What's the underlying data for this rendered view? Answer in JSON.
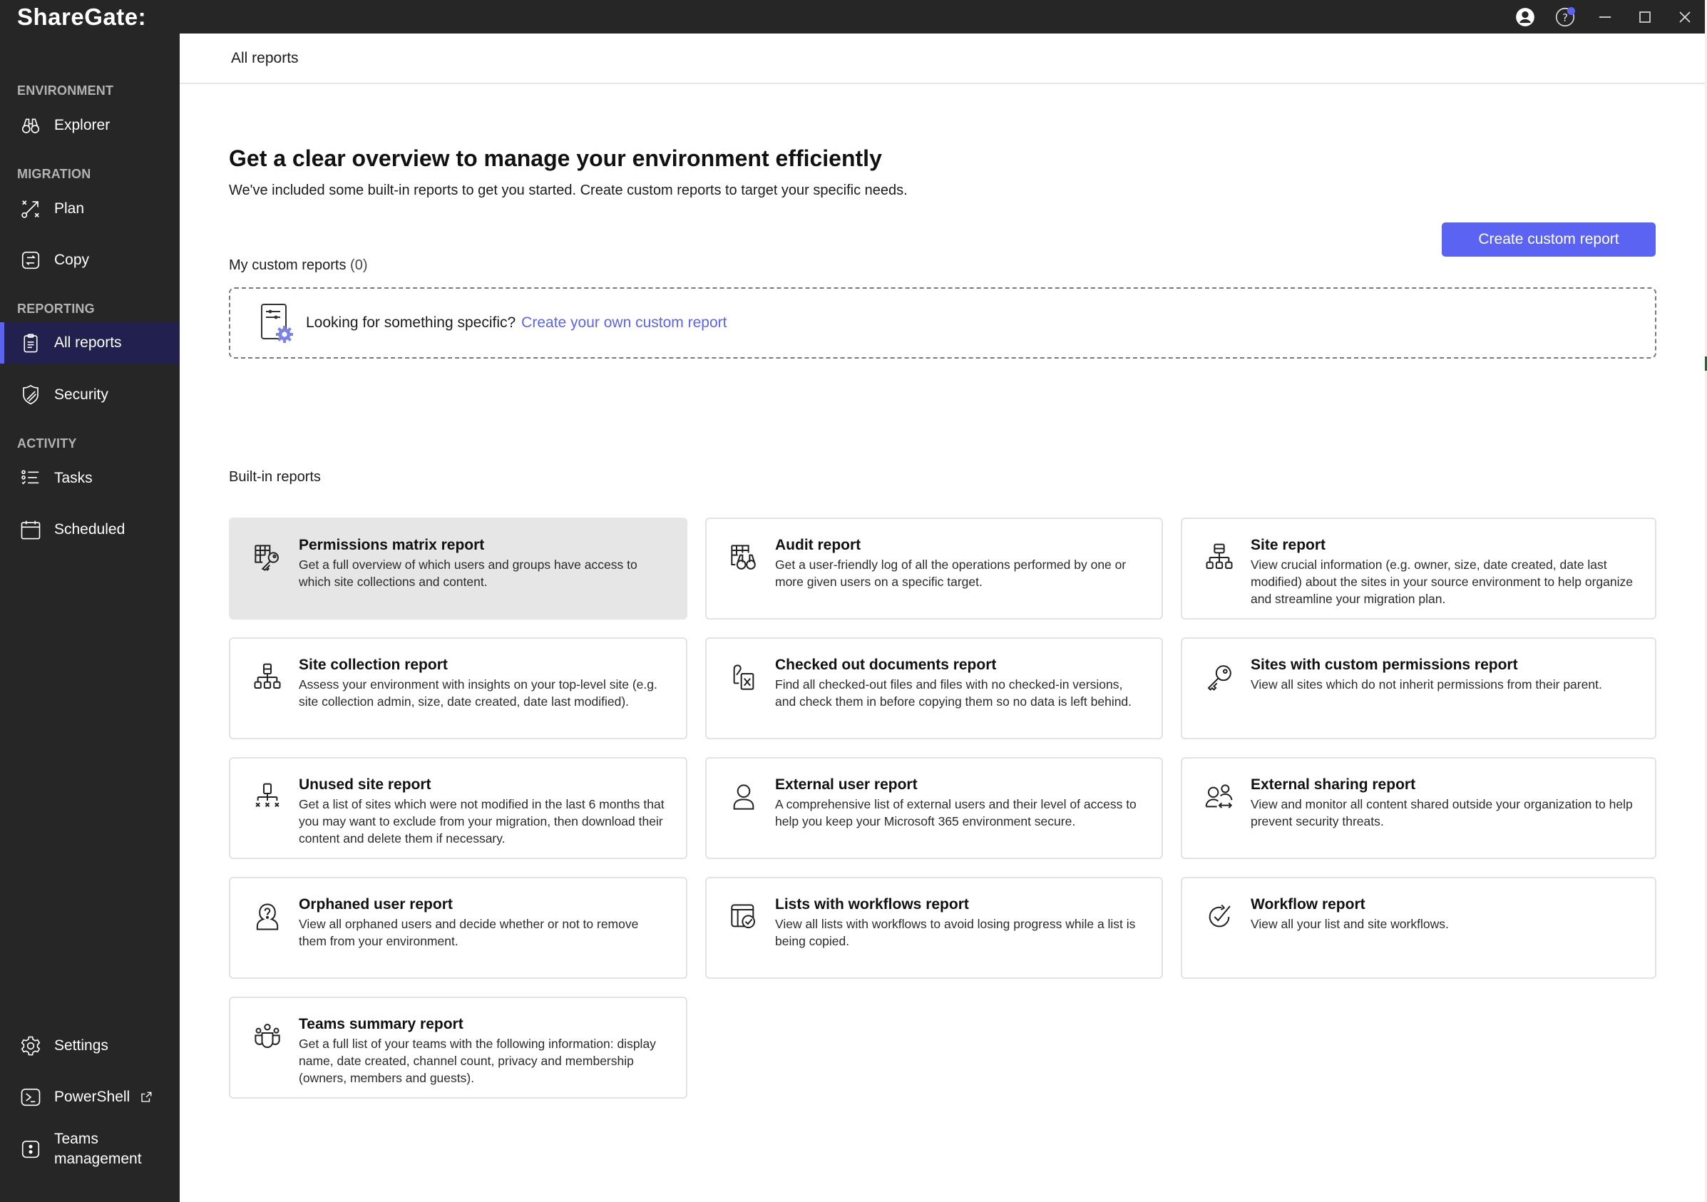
{
  "app": {
    "title": "ShareGate:"
  },
  "titlebar": {
    "icons": [
      "account-icon",
      "help-icon",
      "minimize-icon",
      "maximize-icon",
      "close-icon"
    ],
    "help_badge_color": "#5b63f2"
  },
  "sidebar": {
    "sections": [
      {
        "label": "ENVIRONMENT"
      },
      {
        "label": "MIGRATION"
      },
      {
        "label": "REPORTING"
      },
      {
        "label": "ACTIVITY"
      }
    ],
    "items": [
      {
        "label": "Explorer",
        "icon": "binoculars-icon"
      },
      {
        "label": "Plan",
        "icon": "plan-icon"
      },
      {
        "label": "Copy",
        "icon": "copy-icon"
      },
      {
        "label": "All reports",
        "icon": "clipboard-icon",
        "active": true
      },
      {
        "label": "Security",
        "icon": "shield-icon"
      },
      {
        "label": "Tasks",
        "icon": "tasks-icon"
      },
      {
        "label": "Scheduled",
        "icon": "calendar-icon"
      }
    ],
    "bottom_items": [
      {
        "label": "Settings",
        "icon": "gear-icon"
      },
      {
        "label": "PowerShell",
        "icon": "terminal-icon",
        "external": true
      },
      {
        "label_line1": "Teams",
        "label_line2": "management",
        "icon": "teams-icon"
      }
    ],
    "accent_color": "#5b63f2",
    "active_bg": "#21204f"
  },
  "header": {
    "breadcrumb": "All reports"
  },
  "main": {
    "title": "Get a clear overview to manage your environment efficiently",
    "subtitle": "We've included some built-in reports to get you started. Create custom reports to target your specific needs.",
    "custom_reports_label": "My custom reports",
    "custom_reports_count": "(0)",
    "create_button": "Create custom report",
    "empty_prompt": "Looking for something specific?",
    "empty_link": "Create your own custom report",
    "builtin_label": "Built-in reports",
    "reports": [
      {
        "title": "Permissions matrix report",
        "desc": "Get a full overview of which users and groups have access to which site collections and content.",
        "icon": "permissions-matrix-icon",
        "hovered": true
      },
      {
        "title": "Audit report",
        "desc": "Get a user-friendly log of all the operations performed by one or more given users on a specific target.",
        "icon": "audit-icon"
      },
      {
        "title": "Site report",
        "desc": "View crucial information (e.g. owner, size, date created, date last modified) about the sites in your source environment to help organize and streamline your migration plan.",
        "icon": "site-hierarchy-icon"
      },
      {
        "title": "Site collection report",
        "desc": "Assess your environment with insights on your top-level site (e.g. site collection admin, size, date created, date last modified).",
        "icon": "site-collection-icon"
      },
      {
        "title": "Checked out documents report",
        "desc": "Find all checked-out files and files with no checked-in versions, and check them in before copying them so no data is left behind.",
        "icon": "checked-out-document-icon"
      },
      {
        "title": "Sites with custom permissions report",
        "desc": "View all sites which do not inherit permissions from their parent.",
        "icon": "key-icon"
      },
      {
        "title": "Unused site report",
        "desc": "Get a list of sites which were not modified in the last 6 months that you may want to exclude from your migration, then download their content and delete them if necessary.",
        "icon": "unused-site-icon"
      },
      {
        "title": "External user report",
        "desc": "A comprehensive list of external users and their level of access to help you keep your Microsoft 365 environment secure.",
        "icon": "person-icon"
      },
      {
        "title": "External sharing report",
        "desc": "View and monitor all content shared outside your organization to help prevent security threats.",
        "icon": "external-sharing-icon"
      },
      {
        "title": "Orphaned user report",
        "desc": "View all orphaned users and decide whether or not to remove them from your environment.",
        "icon": "orphaned-user-icon"
      },
      {
        "title": "Lists with workflows report",
        "desc": "View all lists with workflows to avoid losing progress while a list is being copied.",
        "icon": "list-workflow-icon"
      },
      {
        "title": "Workflow report",
        "desc": "View all your list and site workflows.",
        "icon": "workflow-icon"
      },
      {
        "title": "Teams summary report",
        "desc": "Get a full list of your teams with the following information: display name, date created, channel count, privacy and membership (owners, members and guests).",
        "icon": "teams-group-icon"
      }
    ]
  }
}
